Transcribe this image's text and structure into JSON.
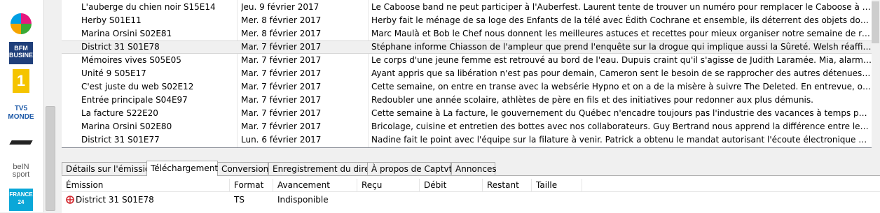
{
  "channels": [
    {
      "name": "channel-a-logo",
      "label": "",
      "colors": [
        "#e5197f",
        "#3aa935",
        "#f5a400",
        "#009fe3"
      ]
    },
    {
      "name": "bfm-business-logo",
      "label": "BFM BUSINESS",
      "colors": [
        "#1f3f7a",
        "#ffffff"
      ]
    },
    {
      "name": "channel-1-logo",
      "label": "1",
      "colors": [
        "#f5c400",
        "#ffffff"
      ]
    },
    {
      "name": "tv5-monde-logo",
      "label": "TV5 MONDE",
      "colors": [
        "#1e5aa8"
      ]
    },
    {
      "name": "channel-swoosh-logo",
      "label": "",
      "colors": [
        "#222222"
      ]
    },
    {
      "name": "bein-sport-logo",
      "label": "beIN sport",
      "colors": [
        "#555555"
      ]
    },
    {
      "name": "france-24-logo",
      "label": "FRANCE 24",
      "colors": [
        "#0aa7d8",
        "#ffffff"
      ]
    }
  ],
  "episodes": [
    {
      "title": "L'auberge du chien noir S15E14",
      "date": "Jeu. 9 février 2017",
      "desc": "Le Caboose band ne peut participer à l'Auberfest. Laurent tente de trouver un numéro pour remplacer le Caboose à cette compétition..."
    },
    {
      "title": "Herby S01E11",
      "date": "Mer. 8 février 2017",
      "desc": "Herby fait le ménage de sa loge des Enfants de la télé avec Édith Cochrane et ensemble, ils déterrent des objets dont elle n'arrive pas à..."
    },
    {
      "title": "Marina Orsini S02E81",
      "date": "Mer. 8 février 2017",
      "desc": "Marc Maulà et Bob le Chef nous donnent les meilleures astuces et recettes pour mieux organiser notre semaine de repas en famille. L..."
    },
    {
      "title": "District 31 S01E78",
      "date": "Mar. 7 février 2017",
      "desc": "Stéphane informe Chiasson de l'ampleur que prend l'enquête sur la drogue qui implique aussi la Sûreté. Welsh réaffirme à son avocat..."
    },
    {
      "title": "Mémoires vives S05E05",
      "date": "Mar. 7 février 2017",
      "desc": "Le corps d'une jeune femme est retrouvé au bord de l'eau. Dupuis craint qu'il s'agisse de Judith Laramée. Mia, alarmée par un appel t..."
    },
    {
      "title": "Unité 9 S05E17",
      "date": "Mar. 7 février 2017",
      "desc": "Ayant appris que sa libération n'est pas pour demain, Cameron sent le besoin de se rapprocher des autres détenues, mais pourra-t-ell..."
    },
    {
      "title": "C'est juste du web S02E12",
      "date": "Mar. 7 février 2017",
      "desc": "Cette semaine, on entre en transe avec la websérie Hypno et on a de la misère à suivre The Deleted. En entrevue, on reçoit celle qui gè..."
    },
    {
      "title": "Entrée principale S04E97",
      "date": "Mar. 7 février 2017",
      "desc": "Redoubler une année scolaire, athlètes de père en fils et des initiatives pour redonner aux plus démunis."
    },
    {
      "title": "La facture S22E20",
      "date": "Mar. 7 février 2017",
      "desc": "Cette semaine à La facture, le gouvernement du Québec n'encadre toujours pas l'industrie des vacances à temps partagé et un dénou..."
    },
    {
      "title": "Marina Orsini S02E80",
      "date": "Mar. 7 février 2017",
      "desc": "Bricolage, cuisine et entretien des bottes avec nos collaborateurs. Guy Bertrand nous apprend la différence entre les sacres et les juron..."
    },
    {
      "title": "District 31 S01E77",
      "date": "Lun. 6 février 2017",
      "desc": "Nadine fait le point avec l'équipe sur la filature à venir. Patrick a obtenu le mandat autorisant l'écoute électronique de Welsh. Le caïd..."
    }
  ],
  "selected_index": 3,
  "tabs": [
    {
      "label": "Détails sur l'émission"
    },
    {
      "label": "Téléchargement"
    },
    {
      "label": "Conversion"
    },
    {
      "label": "Enregistrement du direct"
    },
    {
      "label": "À propos de Captvty"
    },
    {
      "label": "Annonces"
    }
  ],
  "active_tab": 1,
  "downloads": {
    "headers": [
      "Émission",
      "Format",
      "Avancement",
      "Reçu",
      "Débit",
      "Restant",
      "Taille"
    ],
    "rows": [
      {
        "emission": "District 31 S01E78",
        "format": "TS",
        "avancement": "Indisponible",
        "recu": "",
        "debit": "",
        "restant": "",
        "taille": ""
      }
    ]
  },
  "colors": {
    "selection": "#f0f0f0",
    "leaf": "#d2232a"
  }
}
